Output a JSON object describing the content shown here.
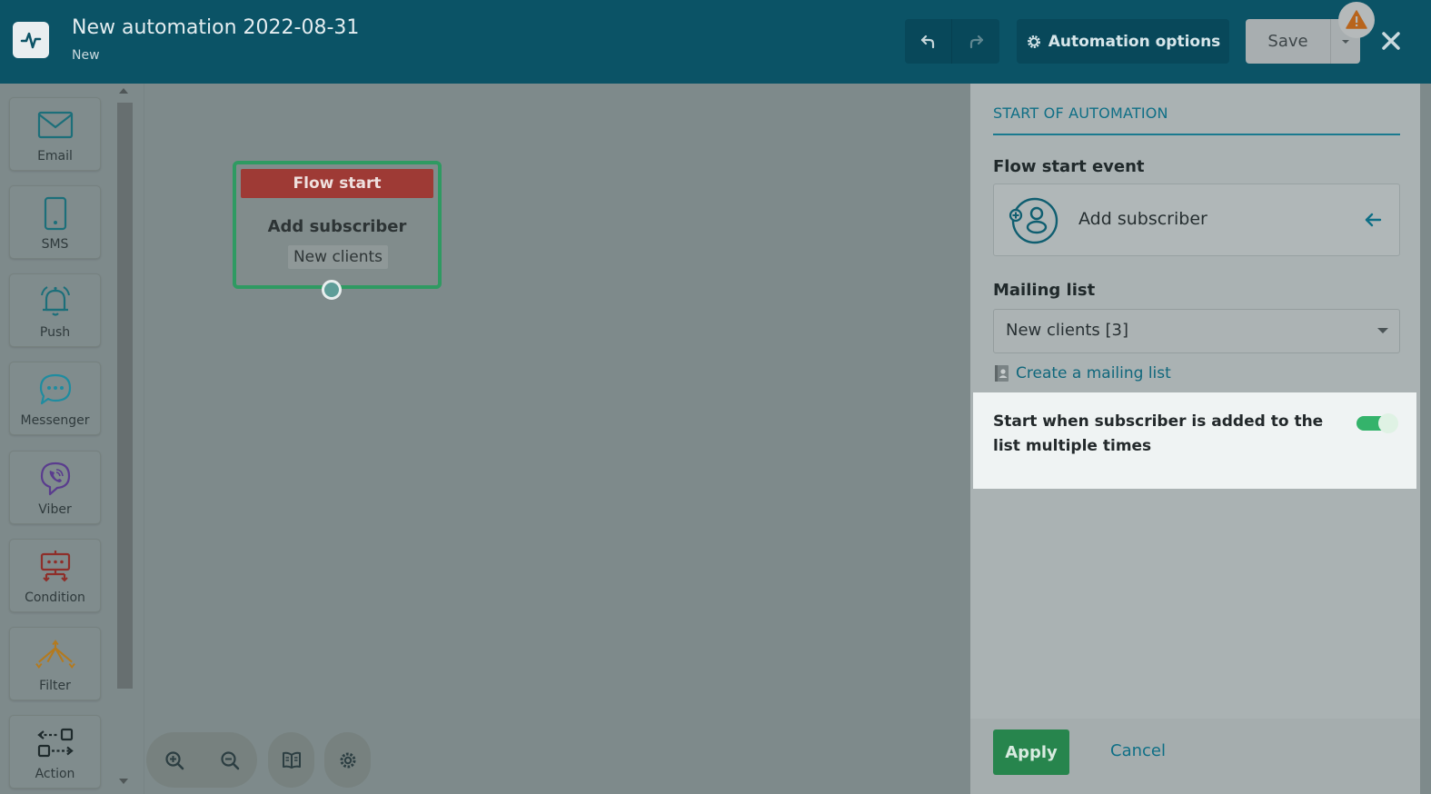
{
  "header": {
    "title": "New automation 2022-08-31",
    "status": "New",
    "automation_options_label": "Automation options",
    "save_label": "Save"
  },
  "sidebar": {
    "tools": [
      {
        "label": "Email",
        "icon": "envelope-icon"
      },
      {
        "label": "SMS",
        "icon": "phone-icon"
      },
      {
        "label": "Push",
        "icon": "bell-icon"
      },
      {
        "label": "Messenger",
        "icon": "chat-bubble-icon"
      },
      {
        "label": "Viber",
        "icon": "viber-icon"
      },
      {
        "label": "Condition",
        "icon": "condition-icon"
      },
      {
        "label": "Filter",
        "icon": "filter-icon"
      },
      {
        "label": "Action",
        "icon": "action-icon"
      }
    ]
  },
  "canvas": {
    "node": {
      "header": "Flow start",
      "event": "Add subscriber",
      "list": "New clients"
    }
  },
  "panel": {
    "heading": "START OF AUTOMATION",
    "flow_start_label": "Flow start event",
    "flow_start_value": "Add subscriber",
    "mailing_list_label": "Mailing list",
    "mailing_list_value": "New clients [3]",
    "create_link": "Create a mailing list",
    "repeat_label": "Start when subscriber is added to the list multiple times",
    "repeat_enabled": true,
    "apply_label": "Apply",
    "cancel_label": "Cancel"
  },
  "colors": {
    "header_bg": "#0b5366",
    "accent": "#0f6f86",
    "flow_head": "#9e3a35",
    "node_border": "#2f9a62",
    "apply": "#27854d",
    "toggle_on": "#34b36b"
  }
}
